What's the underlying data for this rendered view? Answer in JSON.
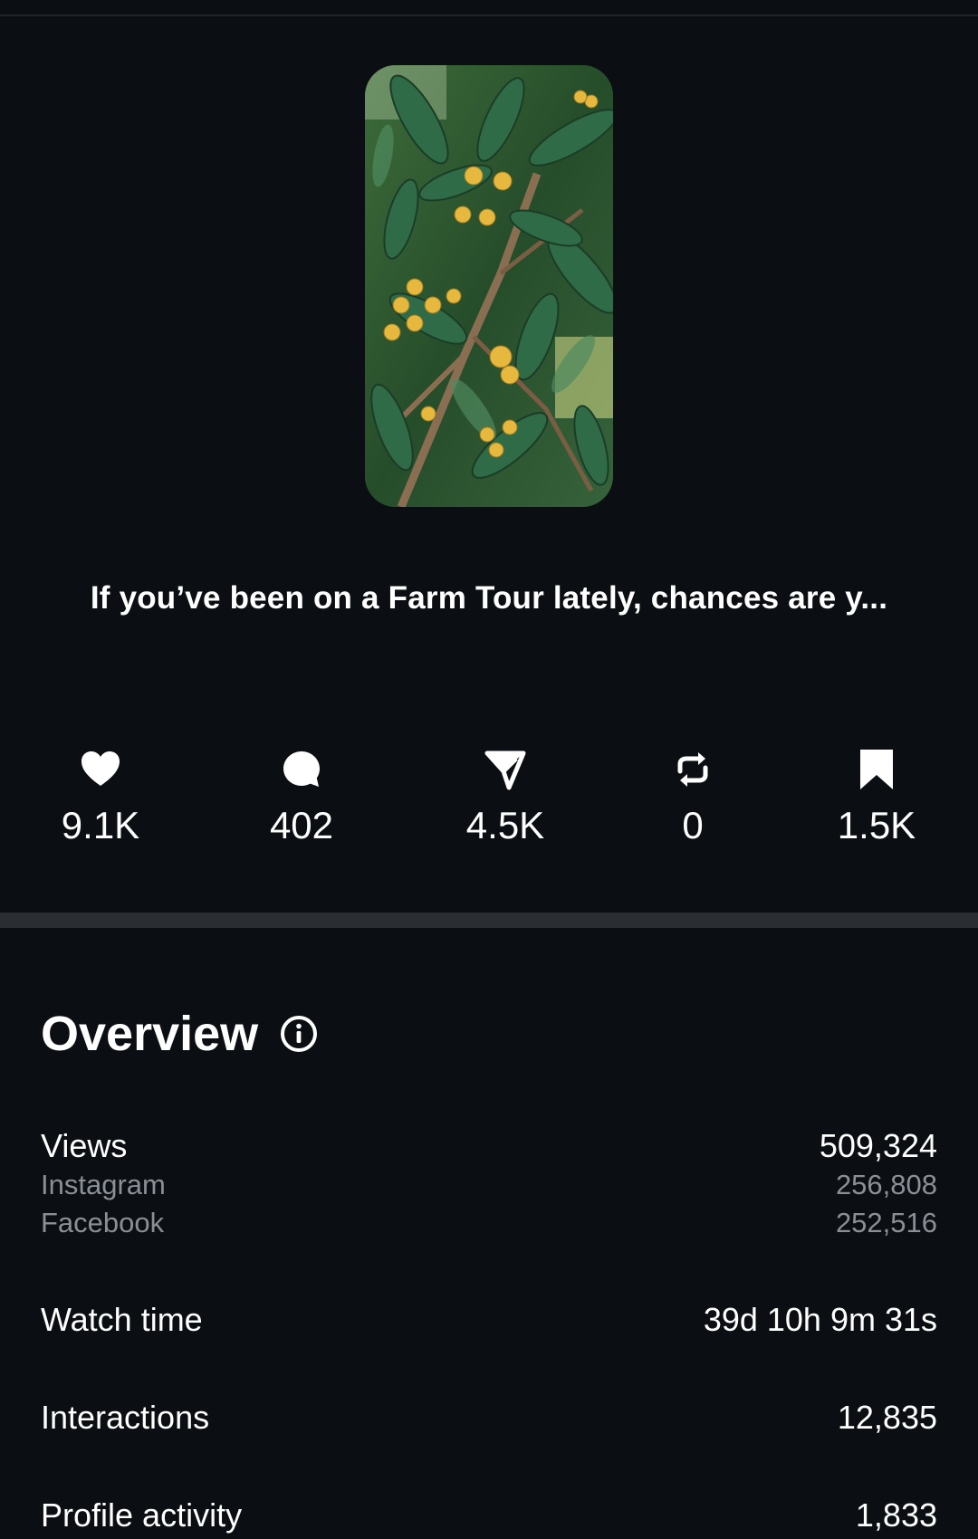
{
  "post": {
    "caption": "If you’ve been on a Farm Tour lately, chances are y...",
    "thumbnail_icon": "loquat-tree-photo"
  },
  "stats": [
    {
      "name": "likes",
      "icon": "heart-icon",
      "value": "9.1K"
    },
    {
      "name": "comments",
      "icon": "comment-icon",
      "value": "402"
    },
    {
      "name": "shares",
      "icon": "send-icon",
      "value": "4.5K"
    },
    {
      "name": "reposts",
      "icon": "repost-icon",
      "value": "0"
    },
    {
      "name": "saves",
      "icon": "bookmark-icon",
      "value": "1.5K"
    }
  ],
  "overview": {
    "title": "Overview",
    "views": {
      "label": "Views",
      "value": "509,324"
    },
    "instagram": {
      "label": "Instagram",
      "value": "256,808"
    },
    "facebook": {
      "label": "Facebook",
      "value": "252,516"
    },
    "watch_time": {
      "label": "Watch time",
      "value": "39d 10h 9m 31s"
    },
    "interactions": {
      "label": "Interactions",
      "value": "12,835"
    },
    "profile_activity": {
      "label": "Profile activity",
      "value": "1,833"
    }
  },
  "colors": {
    "background": "#0b0e12",
    "text": "#ffffff",
    "muted": "#8b9096",
    "divider": "#2a2e33"
  }
}
